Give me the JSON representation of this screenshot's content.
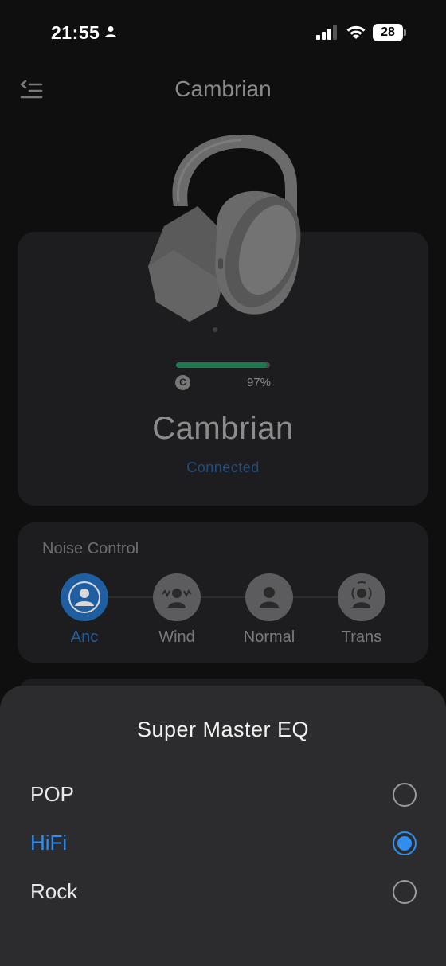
{
  "status_bar": {
    "time": "21:55",
    "battery": "28"
  },
  "header": {
    "title": "Cambrian"
  },
  "device": {
    "battery_level_percent": 97,
    "battery_label": "97%",
    "battery_case_letter": "C",
    "name": "Cambrian",
    "status": "Connected"
  },
  "noise_control": {
    "title": "Noise Control",
    "modes": [
      {
        "label": "Anc",
        "active": true
      },
      {
        "label": "Wind",
        "active": false
      },
      {
        "label": "Normal",
        "active": false
      },
      {
        "label": "Trans",
        "active": false
      }
    ]
  },
  "eq_sheet": {
    "title": "Super Master EQ",
    "options": [
      {
        "label": "POP",
        "selected": false
      },
      {
        "label": "HiFi",
        "selected": true
      },
      {
        "label": "Rock",
        "selected": false
      }
    ]
  },
  "colors": {
    "accent": "#2f8ef0",
    "anc_active": "#1e5ea1",
    "battery_fill": "#1d7a4f"
  }
}
